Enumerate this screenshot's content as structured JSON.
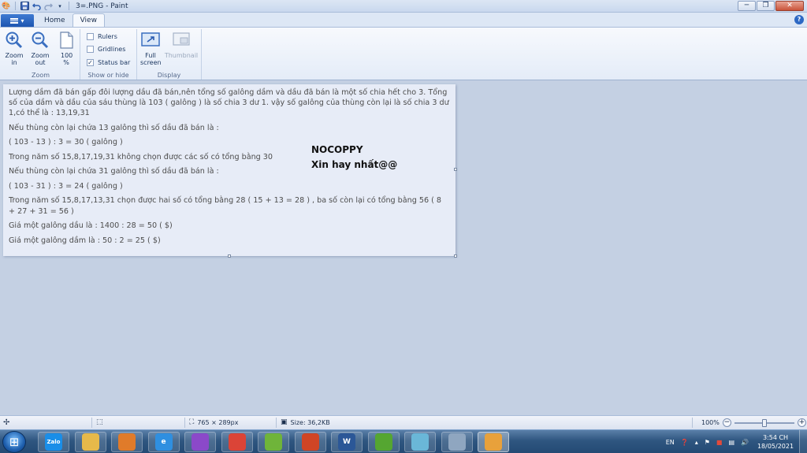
{
  "window": {
    "title": "3=.PNG - Paint",
    "controls": {
      "minimize": "─",
      "maximize": "❐",
      "close": "✕"
    }
  },
  "quick_access": [
    "save-icon",
    "undo-icon",
    "redo-icon",
    "customize-arrow-icon"
  ],
  "tabs": [
    {
      "label": "Home",
      "active": false
    },
    {
      "label": "View",
      "active": true
    }
  ],
  "help_label": "?",
  "ribbon": {
    "zoom": {
      "label": "Zoom",
      "zoom_in": "Zoom in",
      "zoom_out": "Zoom out",
      "hundred": "100 %"
    },
    "show_or_hide": {
      "label": "Show or hide",
      "rulers": {
        "label": "Rulers",
        "checked": false
      },
      "gridlines": {
        "label": "Gridlines",
        "checked": false
      },
      "status_bar": {
        "label": "Status bar",
        "checked": true
      }
    },
    "display": {
      "label": "Display",
      "full_screen": "Full screen",
      "thumbnail": "Thumbnail"
    }
  },
  "canvas": {
    "paragraphs": [
      "Lượng dầm đã bán gấp đôi lượng dầu đã bán,nên tổng số galông dầm và dầu đã bán là một số chia hết cho 3. Tổng số của dầm và dầu của sáu thùng là 103 ( galông ) là số chia 3 dư 1. vậy số galông của thùng còn lại là số chia 3 dư 1,có thể là : 13,19,31",
      "Nếu thùng còn lại chứa 13 galông thì số dầu đã bán là :",
      "( 103 - 13 ) : 3 = 30 ( galông )",
      "Trong năm số 15,8,17,19,31 không chọn được các số có tổng bằng 30",
      "Nếu thùng còn lại chứa 31 galông thì số dầu đã bán là :",
      "( 103 - 31 ) : 3 = 24 ( galông )",
      "Trong năm số 15,8,17,13,31 chọn được hai số có tổng bằng 28 ( 15 + 13 = 28 ) , ba số còn lại có tổng bằng 56 ( 8 + 27 + 31 = 56 )",
      "Giá một galông dầu là : 1400 : 28 = 50 ( $)",
      "Giá một galông dầm là : 50 : 2 = 25 ( $)"
    ],
    "watermark_line1": "NOCOPPY",
    "watermark_line2": "Xin hay nhất@@"
  },
  "statusbar": {
    "dimensions": "765 × 289px",
    "size": "Size: 36,2KB",
    "zoom": "100%",
    "zoom_fraction": 0.5
  },
  "taskbar": {
    "apps": [
      {
        "name": "zalo",
        "label": "Zalo",
        "color": "#1a8ee8"
      },
      {
        "name": "file-explorer",
        "label": "",
        "color": "#e7b94a"
      },
      {
        "name": "media-player",
        "label": "",
        "color": "#e07b2a"
      },
      {
        "name": "internet-explorer",
        "label": "e",
        "color": "#2f8fe0"
      },
      {
        "name": "coc-coc",
        "label": "",
        "color": "#8b49c9"
      },
      {
        "name": "chrome",
        "label": "",
        "color": "#db4437"
      },
      {
        "name": "app-green",
        "label": "",
        "color": "#6fb43a"
      },
      {
        "name": "powerpoint-app",
        "label": "",
        "color": "#d04525"
      },
      {
        "name": "word",
        "label": "W",
        "color": "#2b5797"
      },
      {
        "name": "frog-app",
        "label": "",
        "color": "#55a631"
      },
      {
        "name": "notepad-app",
        "label": "",
        "color": "#6ab7d8"
      },
      {
        "name": "calculator",
        "label": "",
        "color": "#8fa6c0"
      },
      {
        "name": "paint",
        "label": "",
        "color": "#e8a13b"
      }
    ],
    "tray": {
      "language": "EN",
      "time": "3:54 CH",
      "date": "18/05/2021"
    }
  }
}
